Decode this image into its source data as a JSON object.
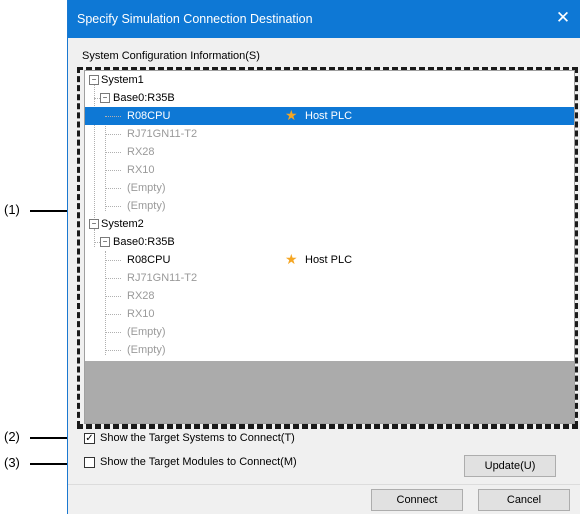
{
  "dialog": {
    "title": "Specify Simulation Connection Destination",
    "close_glyph": "✕"
  },
  "group_label": "System Configuration Information(S)",
  "tree": {
    "system1": {
      "label": "System1",
      "base": "Base0:R35B",
      "modules": [
        "R08CPU",
        "RJ71GN11-T2",
        "RX28",
        "RX10",
        "(Empty)",
        "(Empty)"
      ],
      "host_label": "Host PLC"
    },
    "system2": {
      "label": "System2",
      "base": "Base0:R35B",
      "modules": [
        "R08CPU",
        "RJ71GN11-T2",
        "RX28",
        "RX10",
        "(Empty)",
        "(Empty)"
      ],
      "host_label": "Host PLC"
    },
    "expander_glyph": "−"
  },
  "options": {
    "show_target_systems": "Show the Target Systems to Connect(T)",
    "show_target_systems_checked": true,
    "show_target_modules": "Show the Target Modules to Connect(M)",
    "show_target_modules_checked": false,
    "check_glyph": "✓"
  },
  "buttons": {
    "update": "Update(U)",
    "connect": "Connect",
    "cancel": "Cancel"
  },
  "callouts": [
    "(1)",
    "(2)",
    "(3)"
  ],
  "icons": {
    "host_star": "★"
  },
  "colors": {
    "title_bar": "#0e78d5",
    "selection": "#0e78d5",
    "star": "#f5a623"
  }
}
